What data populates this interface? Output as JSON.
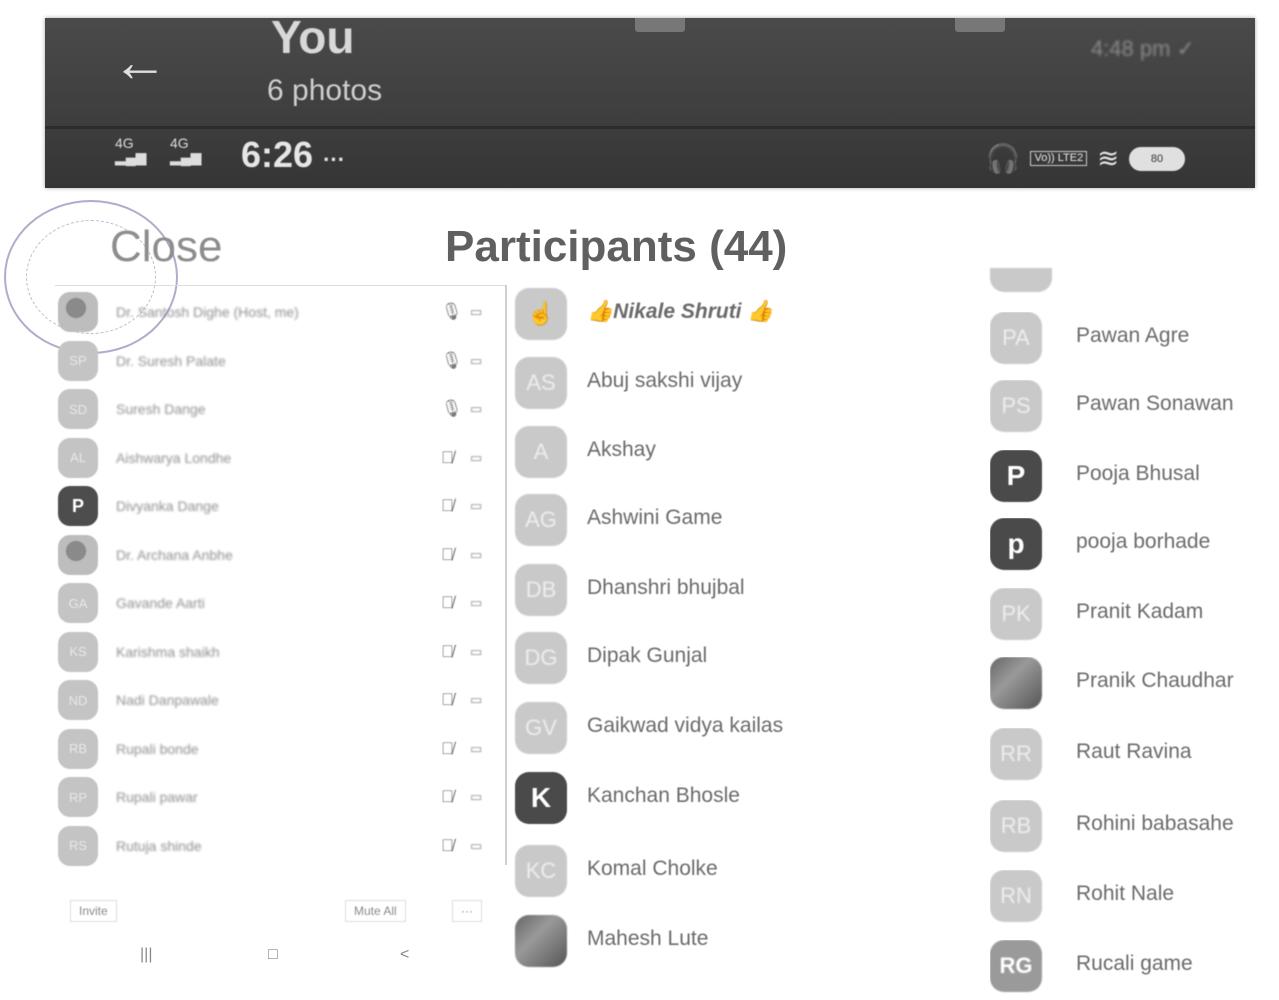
{
  "viewer": {
    "title": "You",
    "subtitle": "6 photos",
    "time_right": "4:48 pm ✓",
    "back_icon": "back-arrow-icon"
  },
  "status_bar": {
    "signal_1": "4G",
    "signal_2": "4G",
    "clock": "6:26",
    "clock_more": "···",
    "lte": "Vo)) LTE2",
    "battery": "80"
  },
  "panel": {
    "close": "Close",
    "title": "Participants (44)",
    "invite": "Invite",
    "mute_all": "Mute All",
    "more": "···"
  },
  "left_list": [
    {
      "initials": "",
      "name": "Dr. Santosh Dighe (Host, me)",
      "style": "photo",
      "muted": false
    },
    {
      "initials": "SP",
      "name": "Dr. Suresh Palate",
      "style": "",
      "muted": false
    },
    {
      "initials": "SD",
      "name": "Suresh Dange",
      "style": "",
      "muted": false
    },
    {
      "initials": "AL",
      "name": "Aishwarya Londhe",
      "style": "",
      "muted": true
    },
    {
      "initials": "P",
      "name": "Divyanka Dange",
      "style": "dark",
      "muted": true
    },
    {
      "initials": "",
      "name": "Dr. Archana Anbhe",
      "style": "photo",
      "muted": true
    },
    {
      "initials": "GA",
      "name": "Gavande Aarti",
      "style": "",
      "muted": true
    },
    {
      "initials": "KS",
      "name": "Karishma shaikh",
      "style": "",
      "muted": true
    },
    {
      "initials": "ND",
      "name": "Nadi Danpawale",
      "style": "",
      "muted": true
    },
    {
      "initials": "RB",
      "name": "Rupali bonde",
      "style": "",
      "muted": true
    },
    {
      "initials": "RP",
      "name": "Rupali pawar",
      "style": "",
      "muted": true
    },
    {
      "initials": "RS",
      "name": "Rutuja shinde",
      "style": "",
      "muted": true
    }
  ],
  "middle_list": [
    {
      "initials": "☝",
      "name": "👍Nikale Shruti 👍",
      "style": "",
      "italic": true
    },
    {
      "initials": "AS",
      "name": "Abuj sakshi  vijay",
      "style": ""
    },
    {
      "initials": "A",
      "name": "Akshay",
      "style": ""
    },
    {
      "initials": "AG",
      "name": "Ashwini Game",
      "style": ""
    },
    {
      "initials": "DB",
      "name": "Dhanshri bhujbal",
      "style": ""
    },
    {
      "initials": "DG",
      "name": "Dipak Gunjal",
      "style": ""
    },
    {
      "initials": "GV",
      "name": "Gaikwad vidya kailas",
      "style": ""
    },
    {
      "initials": "K",
      "name": "Kanchan Bhosle",
      "style": "dark"
    },
    {
      "initials": "KC",
      "name": "Komal Cholke",
      "style": ""
    },
    {
      "initials": "",
      "name": "Mahesh Lute",
      "style": "photo"
    }
  ],
  "right_list": [
    {
      "initials": "PA",
      "name": "Pawan Agre",
      "style": ""
    },
    {
      "initials": "PS",
      "name": "Pawan Sonawan",
      "style": ""
    },
    {
      "initials": "P",
      "name": "Pooja Bhusal",
      "style": "dark"
    },
    {
      "initials": "p",
      "name": "pooja borhade",
      "style": "dark"
    },
    {
      "initials": "PK",
      "name": "Pranit Kadam",
      "style": ""
    },
    {
      "initials": "",
      "name": "Pranik Chaudhar",
      "style": "photo"
    },
    {
      "initials": "RR",
      "name": "Raut Ravina",
      "style": ""
    },
    {
      "initials": "RB",
      "name": "Rohini babasahe",
      "style": ""
    },
    {
      "initials": "RN",
      "name": "Rohit Nale",
      "style": ""
    },
    {
      "initials": "RG",
      "name": "Rucali game",
      "style": "mid"
    }
  ],
  "nav": {
    "back": "<",
    "home": "□",
    "recents": "|||"
  }
}
